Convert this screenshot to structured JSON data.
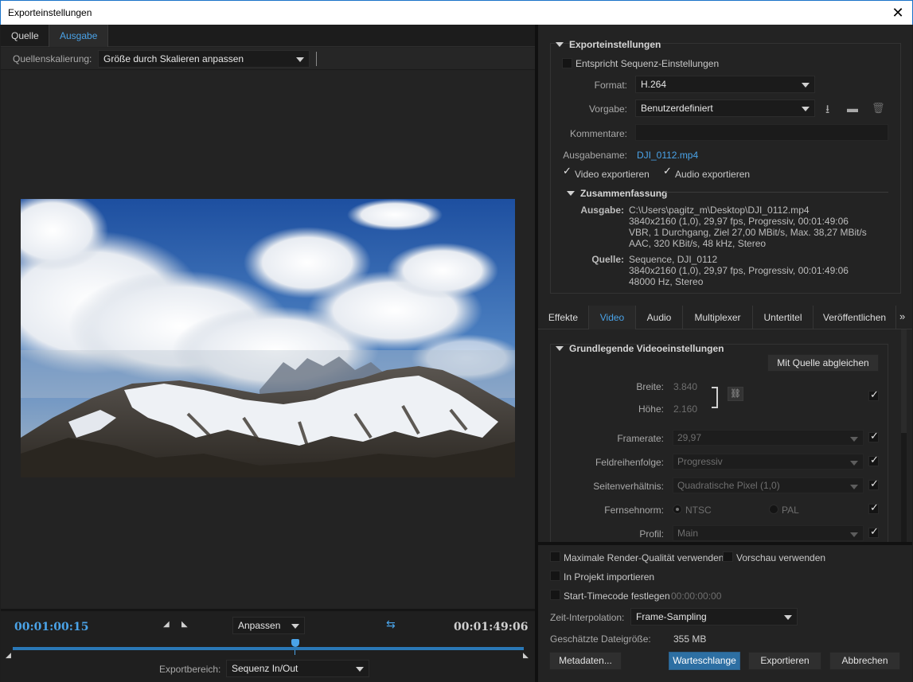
{
  "window": {
    "title": "Exporteinstellungen",
    "close_glyph": "✕"
  },
  "left": {
    "tabs": [
      {
        "label": "Quelle"
      },
      {
        "label": "Ausgabe"
      }
    ],
    "scaling_label": "Quellenskalierung:",
    "scaling_value": "Größe durch Skalieren anpassen",
    "timeline": {
      "current": "00:01:00:15",
      "duration": "00:01:49:06",
      "fit_value": "Anpassen",
      "range_label": "Exportbereich:",
      "range_value": "Sequenz In/Out"
    }
  },
  "export": {
    "section_title": "Exporteinstellungen",
    "match_sequence_label": "Entspricht Sequenz-Einstellungen",
    "format_label": "Format:",
    "format_value": "H.264",
    "preset_label": "Vorgabe:",
    "preset_value": "Benutzerdefiniert",
    "comments_label": "Kommentare:",
    "output_name_label": "Ausgabename:",
    "output_name_value": "DJI_0112.mp4",
    "export_video_label": "Video exportieren",
    "export_audio_label": "Audio exportieren",
    "summary": {
      "title": "Zusammenfassung",
      "output_label": "Ausgabe:",
      "output_lines": [
        "C:\\Users\\pagitz_m\\Desktop\\DJI_0112.mp4",
        "3840x2160 (1,0), 29,97 fps, Progressiv, 00:01:49:06",
        "VBR, 1 Durchgang, Ziel 27,00 MBit/s, Max. 38,27 MBit/s",
        "AAC, 320 KBit/s, 48 kHz, Stereo"
      ],
      "source_label": "Quelle:",
      "source_lines": [
        "Sequence, DJI_0112",
        "3840x2160 (1,0), 29,97 fps, Progressiv, 00:01:49:06",
        "48000 Hz, Stereo"
      ]
    }
  },
  "tabs2": [
    {
      "label": "Effekte"
    },
    {
      "label": "Video"
    },
    {
      "label": "Audio"
    },
    {
      "label": "Multiplexer"
    },
    {
      "label": "Untertitel"
    },
    {
      "label": "Veröffentlichen"
    }
  ],
  "video": {
    "section_title": "Grundlegende Videoeinstellungen",
    "match_source_button": "Mit Quelle abgleichen",
    "width_label": "Breite:",
    "width_value": "3.840",
    "height_label": "Höhe:",
    "height_value": "2.160",
    "framerate_label": "Framerate:",
    "framerate_value": "29,97",
    "field_order_label": "Feldreihenfolge:",
    "field_order_value": "Progressiv",
    "aspect_label": "Seitenverhältnis:",
    "aspect_value": "Quadratische Pixel (1,0)",
    "tv_standard_label": "Fernsehnorm:",
    "ntsc_label": "NTSC",
    "pal_label": "PAL",
    "profile_label": "Profil:",
    "profile_value": "Main"
  },
  "bottom": {
    "max_quality_label": "Maximale Render-Qualität verwenden",
    "use_preview_label": "Vorschau verwenden",
    "import_project_label": "In Projekt importieren",
    "start_timecode_label": "Start-Timecode festlegen",
    "start_timecode_value": "00:00:00:00",
    "time_interp_label": "Zeit-Interpolation:",
    "time_interp_value": "Frame-Sampling",
    "file_size_label": "Geschätzte Dateigröße:",
    "file_size_value": "355 MB",
    "metadata_button": "Metadaten...",
    "queue_button": "Warteschlange",
    "export_button": "Exportieren",
    "cancel_button": "Abbrechen"
  },
  "colors": {
    "accent": "#4aa3e8",
    "primary_button": "#2d6fa3",
    "background": "#232323"
  }
}
